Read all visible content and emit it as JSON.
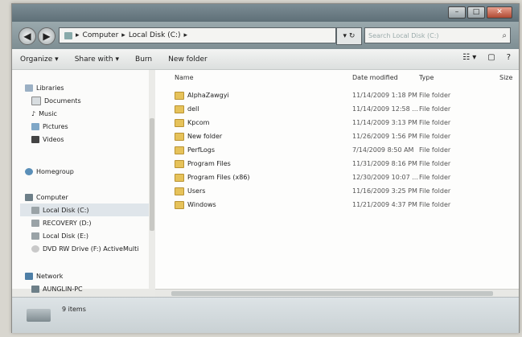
{
  "window": {
    "controls": {
      "minimize": "–",
      "maximize": "□",
      "close": "✕"
    }
  },
  "address": {
    "crumbs": [
      "Computer",
      "Local Disk (C:)"
    ],
    "separator": "▸",
    "refresh": "▾ ↻",
    "search_placeholder": "Search Local Disk (C:)"
  },
  "toolbar": {
    "organize": "Organize ▾",
    "share_with": "Share with ▾",
    "burn": "Burn",
    "new_folder": "New folder"
  },
  "sidebar": {
    "libraries": {
      "label": "Libraries",
      "items": [
        "Documents",
        "Music",
        "Pictures",
        "Videos"
      ]
    },
    "homegroup": "Homegroup",
    "computer": {
      "label": "Computer",
      "items": [
        "Local Disk (C:)",
        "RECOVERY (D:)",
        "Local Disk (E:)",
        "DVD RW Drive (F:) ActiveMulti"
      ]
    },
    "network": {
      "label": "Network",
      "items": [
        "AUNGLIN-PC"
      ]
    }
  },
  "columns": {
    "name": "Name",
    "date": "Date modified",
    "type": "Type",
    "size": "Size"
  },
  "files": [
    {
      "name": "AlphaZawgyi",
      "date": "11/14/2009 1:18 PM",
      "type": "File folder"
    },
    {
      "name": "dell",
      "date": "11/14/2009 12:58 ...",
      "type": "File folder"
    },
    {
      "name": "Kpcom",
      "date": "11/14/2009 3:13 PM",
      "type": "File folder"
    },
    {
      "name": "New folder",
      "date": "11/26/2009 1:56 PM",
      "type": "File folder"
    },
    {
      "name": "PerfLogs",
      "date": "7/14/2009 8:50 AM",
      "type": "File folder"
    },
    {
      "name": "Program Files",
      "date": "11/31/2009 8:16 PM",
      "type": "File folder"
    },
    {
      "name": "Program Files (x86)",
      "date": "12/30/2009 10:07 ...",
      "type": "File folder"
    },
    {
      "name": "Users",
      "date": "11/16/2009 3:25 PM",
      "type": "File folder"
    },
    {
      "name": "Windows",
      "date": "11/21/2009 4:37 PM",
      "type": "File folder"
    }
  ],
  "status": {
    "count": "9 items"
  },
  "colors": {
    "accent": "#5e6f77",
    "folder": "#e6c25a"
  }
}
